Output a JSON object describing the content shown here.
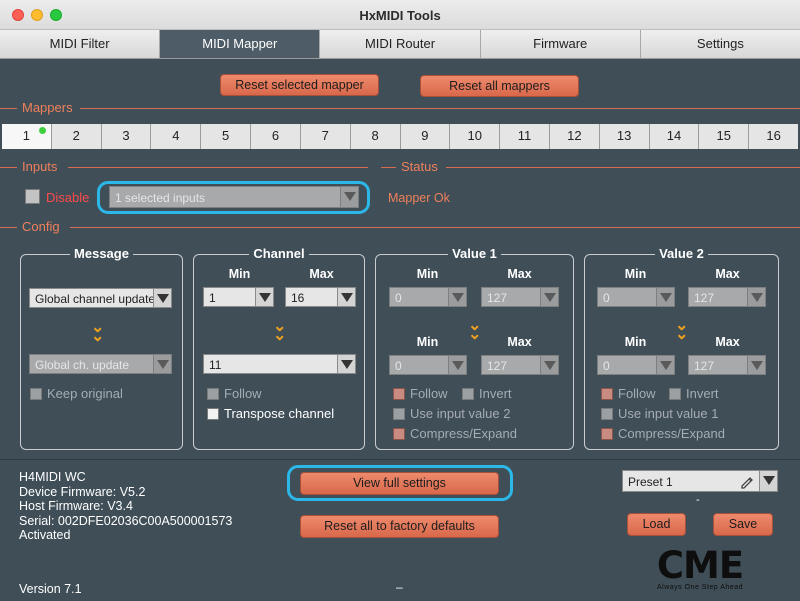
{
  "window": {
    "title": "HxMIDI Tools"
  },
  "tabs": [
    "MIDI Filter",
    "MIDI Mapper",
    "MIDI Router",
    "Firmware",
    "Settings"
  ],
  "top_buttons": {
    "reset_selected": "Reset selected mapper",
    "reset_all": "Reset all mappers"
  },
  "sections": {
    "mappers": "Mappers",
    "inputs": "Inputs",
    "status": "Status",
    "config": "Config"
  },
  "mappers": [
    "1",
    "2",
    "3",
    "4",
    "5",
    "6",
    "7",
    "8",
    "9",
    "10",
    "11",
    "12",
    "13",
    "14",
    "15",
    "16"
  ],
  "inputs": {
    "disable_label": "Disable",
    "selected": "1 selected inputs"
  },
  "status": {
    "text": "Mapper Ok"
  },
  "message": {
    "title": "Message",
    "select": "Global channel update",
    "select2": "Global ch. update",
    "keep_original": "Keep original"
  },
  "channel": {
    "title": "Channel",
    "min_label": "Min",
    "max_label": "Max",
    "min": "1",
    "max": "16",
    "target": "11",
    "follow": "Follow",
    "transpose": "Transpose channel"
  },
  "value1": {
    "title": "Value 1",
    "min_label": "Min",
    "max_label": "Max",
    "min": "0",
    "max": "127",
    "min2": "0",
    "max2": "127",
    "follow": "Follow",
    "invert": "Invert",
    "use_input": "Use input value 2",
    "compress": "Compress/Expand"
  },
  "value2": {
    "title": "Value 2",
    "min_label": "Min",
    "max_label": "Max",
    "min": "0",
    "max": "127",
    "min2": "0",
    "max2": "127",
    "follow": "Follow",
    "invert": "Invert",
    "use_input": "Use input value 1",
    "compress": "Compress/Expand"
  },
  "device": {
    "name": "H4MIDI WC",
    "firmware": "Device Firmware: V5.2",
    "host_firmware": "Host Firmware: V3.4",
    "serial": "Serial: 002DFE02036C00A500001573",
    "activated": "Activated",
    "version": "Version 7.1"
  },
  "bottom_buttons": {
    "view_full": "View full settings",
    "factory": "Reset all to factory defaults"
  },
  "preset": {
    "selected": "Preset 1",
    "dash": "-",
    "load": "Load",
    "save": "Save"
  },
  "logo": {
    "text": "CME",
    "tagline": "Always One Step Ahead"
  },
  "footer": {
    "center_mark": "–"
  },
  "colors": {
    "accent": "#f0805c",
    "highlight": "#2bb7e8",
    "background": "#3f4e57"
  }
}
